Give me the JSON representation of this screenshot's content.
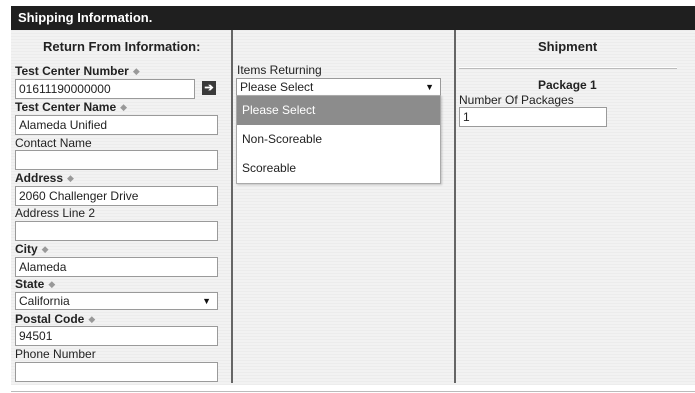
{
  "header": {
    "title": "Shipping Information."
  },
  "return_from": {
    "title": "Return From Information:",
    "test_center_number": {
      "label": "Test Center Number",
      "required": true,
      "value": "01611190000000"
    },
    "test_center_name": {
      "label": "Test Center Name",
      "required": true,
      "value": "Alameda Unified"
    },
    "contact_name": {
      "label": "Contact Name",
      "required": false,
      "value": ""
    },
    "address": {
      "label": "Address",
      "required": true,
      "value": "2060 Challenger Drive"
    },
    "address_line_2": {
      "label": "Address Line 2",
      "required": false,
      "value": ""
    },
    "city": {
      "label": "City",
      "required": true,
      "value": "Alameda"
    },
    "state": {
      "label": "State",
      "required": true,
      "value": "California"
    },
    "postal_code": {
      "label": "Postal Code",
      "required": true,
      "value": "94501"
    },
    "phone_number": {
      "label": "Phone Number",
      "required": false,
      "value": ""
    },
    "required_marker": "◆",
    "go_icon": "arrow-right-icon"
  },
  "items_returning": {
    "label": "Items Returning",
    "selected": "Please Select",
    "options": [
      "Please Select",
      "Non-Scoreable",
      "Scoreable"
    ]
  },
  "shipment": {
    "title": "Shipment",
    "package_title": "Package 1",
    "number_of_packages": {
      "label": "Number Of Packages",
      "value": "1"
    }
  },
  "colors": {
    "header_bg": "#1f1f1f",
    "selected_option_bg": "#8c8c8c",
    "panel_bg": "#f2f2f2"
  }
}
